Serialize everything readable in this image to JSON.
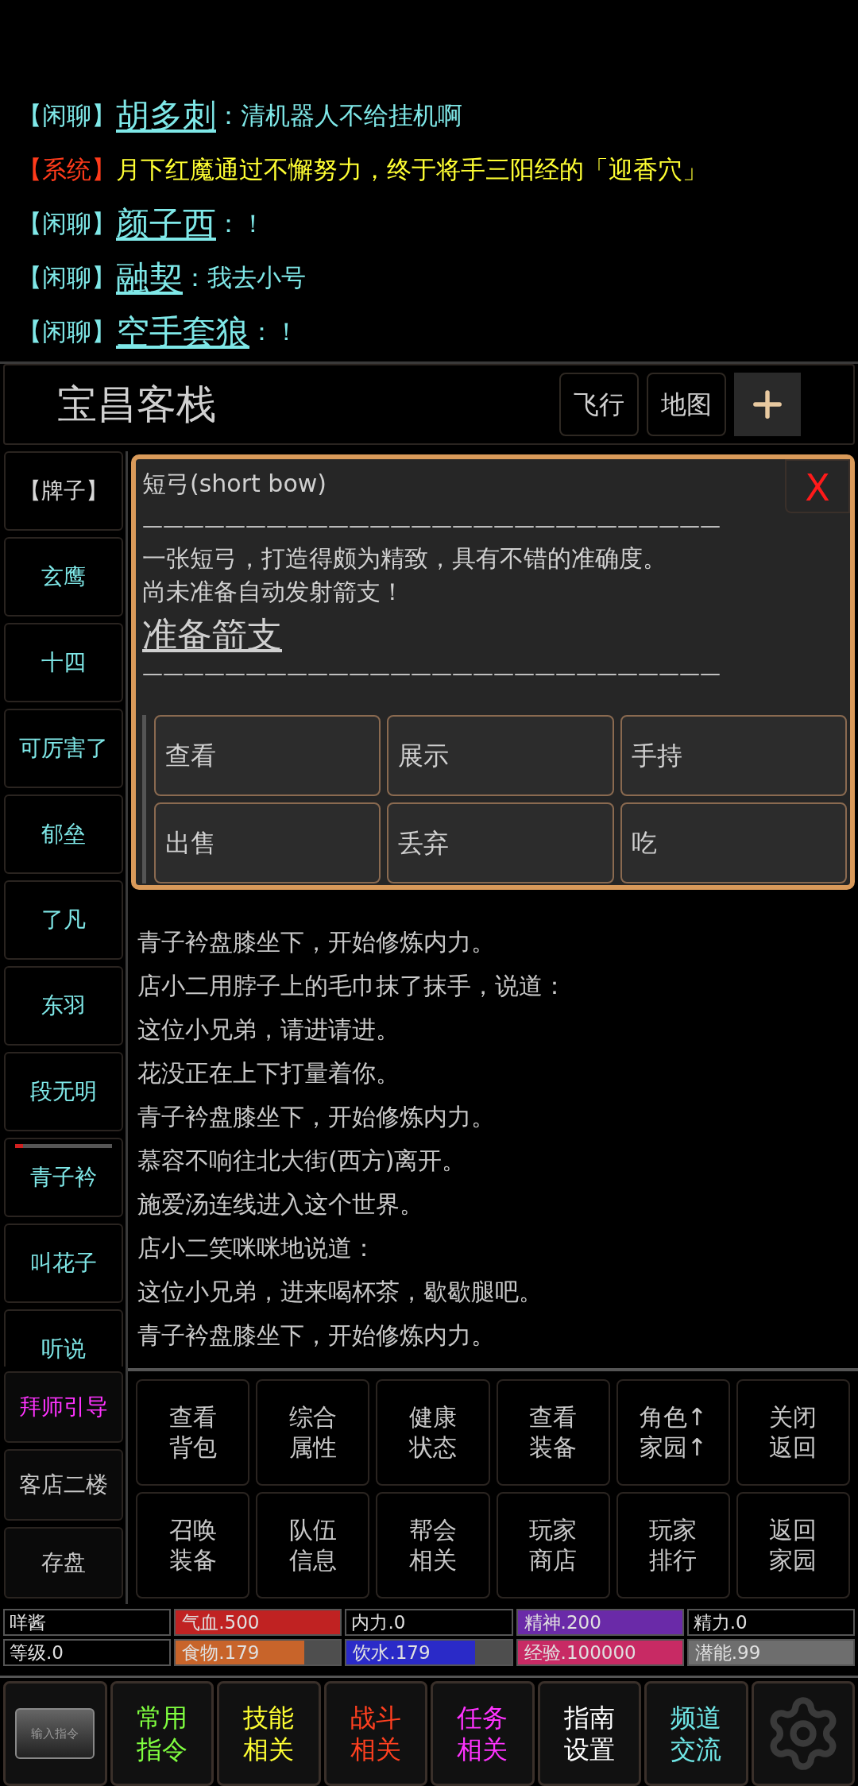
{
  "chat": [
    {
      "kind": "chat",
      "channel": "【闲聊】",
      "name": "胡多刺",
      "message": "：清机器人不给挂机啊"
    },
    {
      "kind": "system",
      "channel": "【系统】",
      "message": "月下红魔通过不懈努力，终于将手三阳经的「迎香穴」"
    },
    {
      "kind": "chat",
      "channel": "【闲聊】",
      "name": "颜子西",
      "message": "：！"
    },
    {
      "kind": "chat",
      "channel": "【闲聊】",
      "name": "融契",
      "message": "：我去小号"
    },
    {
      "kind": "chat",
      "channel": "【闲聊】",
      "name": "空手套狼",
      "message": "：！"
    }
  ],
  "room": {
    "title": "宝昌客栈",
    "buttons": [
      "飞行",
      "地图"
    ]
  },
  "sidebar": {
    "players": [
      {
        "label": "【牌子】",
        "color": "#d8d8d8"
      },
      {
        "label": "玄鹰",
        "color": "#7fe8e8"
      },
      {
        "label": "十四",
        "color": "#7fe8e8"
      },
      {
        "label": "可厉害了",
        "color": "#7fe8e8"
      },
      {
        "label": "郁垒",
        "color": "#7fe8e8"
      },
      {
        "label": "了凡",
        "color": "#7fe8e8"
      },
      {
        "label": "东羽",
        "color": "#7fe8e8"
      },
      {
        "label": "段无明",
        "color": "#7fe8e8"
      },
      {
        "label": "青子衿",
        "color": "#7fe8e8",
        "level": 0.08
      },
      {
        "label": "叫花子",
        "color": "#7fe8e8"
      },
      {
        "label": "听说",
        "color": "#7fe8e8"
      }
    ],
    "fixed": [
      {
        "label": "拜师引导",
        "color": "#ff33ff"
      },
      {
        "label": "客店二楼",
        "color": "#c8c8c8"
      },
      {
        "label": "存盘",
        "color": "#c8c8c8"
      }
    ]
  },
  "popup": {
    "title": "短弓(short bow)",
    "close": "X",
    "rule": "————————————————————————————",
    "description": [
      "一张短弓，打造得颇为精致，具有不错的准确度。",
      "尚未准备自动发射箭支！"
    ],
    "link": "准备箭支",
    "actions": [
      "查看",
      "展示",
      "手持",
      "出售",
      "丢弃",
      "吃"
    ]
  },
  "log": [
    "青子衿盘膝坐下，开始修炼内力。",
    "店小二用脖子上的毛巾抹了抹手，说道：",
    "这位小兄弟，请进请进。",
    "花没正在上下打量着你。",
    "青子衿盘膝坐下，开始修炼内力。",
    "慕容不响往北大街(西方)离开。",
    "施爱汤连线进入这个世界。",
    "店小二笑咪咪地说道：",
    "这位小兄弟，进来喝杯茶，歇歇腿吧。",
    "青子衿盘膝坐下，开始修炼内力。"
  ],
  "commands": [
    [
      "查看",
      "背包"
    ],
    [
      "综合",
      "属性"
    ],
    [
      "健康",
      "状态"
    ],
    [
      "查看",
      "装备"
    ],
    [
      "角色↑",
      "家园↑"
    ],
    [
      "关闭",
      "返回"
    ],
    [
      "召唤",
      "装备"
    ],
    [
      "队伍",
      "信息"
    ],
    [
      "帮会",
      "相关"
    ],
    [
      "玩家",
      "商店"
    ],
    [
      "玩家",
      "排行"
    ],
    [
      "返回",
      "家园"
    ]
  ],
  "stats": [
    {
      "kind": "plain",
      "label": "咩酱"
    },
    {
      "kind": "bar",
      "label": "气血.500",
      "color": "#c02222",
      "level": 1
    },
    {
      "kind": "plain",
      "label": "内力.0"
    },
    {
      "kind": "bar",
      "label": "精神.200",
      "color": "#6a2aa8",
      "level": 1
    },
    {
      "kind": "plain",
      "label": "精力.0"
    },
    {
      "kind": "plain",
      "label": "等级.0"
    },
    {
      "kind": "bar",
      "label": "食物.179",
      "color": "#c8642a",
      "level": 0.78
    },
    {
      "kind": "bar",
      "label": "饮水.179",
      "color": "#2a2ac8",
      "level": 0.78
    },
    {
      "kind": "bar",
      "label": "经验.100000",
      "color": "#c82a64",
      "level": 1
    },
    {
      "kind": "bar",
      "label": "潜能.99",
      "color": "#6e6e6e",
      "level": 1
    }
  ],
  "nav": [
    {
      "kind": "key",
      "label": "输入指令"
    },
    {
      "kind": "text",
      "label": [
        "常用",
        "指令"
      ],
      "color": "#80ff40"
    },
    {
      "kind": "text",
      "label": [
        "技能",
        "相关"
      ],
      "color": "#ffff33"
    },
    {
      "kind": "text",
      "label": [
        "战斗",
        "相关"
      ],
      "color": "#ff4020"
    },
    {
      "kind": "text",
      "label": [
        "任务",
        "相关"
      ],
      "color": "#ff33ff"
    },
    {
      "kind": "text",
      "label": [
        "指南",
        "设置"
      ],
      "color": "#ffffff"
    },
    {
      "kind": "text",
      "label": [
        "频道",
        "交流"
      ],
      "color": "#70e8e8"
    },
    {
      "kind": "gear"
    }
  ]
}
